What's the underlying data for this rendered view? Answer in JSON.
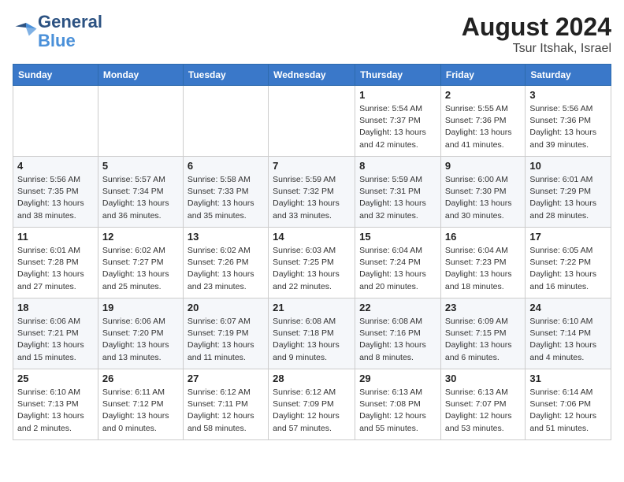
{
  "header": {
    "logo_line1": "General",
    "logo_line2": "Blue",
    "month_year": "August 2024",
    "location": "Tsur Itshak, Israel"
  },
  "weekdays": [
    "Sunday",
    "Monday",
    "Tuesday",
    "Wednesday",
    "Thursday",
    "Friday",
    "Saturday"
  ],
  "weeks": [
    [
      {
        "day": "",
        "info": ""
      },
      {
        "day": "",
        "info": ""
      },
      {
        "day": "",
        "info": ""
      },
      {
        "day": "",
        "info": ""
      },
      {
        "day": "1",
        "info": "Sunrise: 5:54 AM\nSunset: 7:37 PM\nDaylight: 13 hours\nand 42 minutes."
      },
      {
        "day": "2",
        "info": "Sunrise: 5:55 AM\nSunset: 7:36 PM\nDaylight: 13 hours\nand 41 minutes."
      },
      {
        "day": "3",
        "info": "Sunrise: 5:56 AM\nSunset: 7:36 PM\nDaylight: 13 hours\nand 39 minutes."
      }
    ],
    [
      {
        "day": "4",
        "info": "Sunrise: 5:56 AM\nSunset: 7:35 PM\nDaylight: 13 hours\nand 38 minutes."
      },
      {
        "day": "5",
        "info": "Sunrise: 5:57 AM\nSunset: 7:34 PM\nDaylight: 13 hours\nand 36 minutes."
      },
      {
        "day": "6",
        "info": "Sunrise: 5:58 AM\nSunset: 7:33 PM\nDaylight: 13 hours\nand 35 minutes."
      },
      {
        "day": "7",
        "info": "Sunrise: 5:59 AM\nSunset: 7:32 PM\nDaylight: 13 hours\nand 33 minutes."
      },
      {
        "day": "8",
        "info": "Sunrise: 5:59 AM\nSunset: 7:31 PM\nDaylight: 13 hours\nand 32 minutes."
      },
      {
        "day": "9",
        "info": "Sunrise: 6:00 AM\nSunset: 7:30 PM\nDaylight: 13 hours\nand 30 minutes."
      },
      {
        "day": "10",
        "info": "Sunrise: 6:01 AM\nSunset: 7:29 PM\nDaylight: 13 hours\nand 28 minutes."
      }
    ],
    [
      {
        "day": "11",
        "info": "Sunrise: 6:01 AM\nSunset: 7:28 PM\nDaylight: 13 hours\nand 27 minutes."
      },
      {
        "day": "12",
        "info": "Sunrise: 6:02 AM\nSunset: 7:27 PM\nDaylight: 13 hours\nand 25 minutes."
      },
      {
        "day": "13",
        "info": "Sunrise: 6:02 AM\nSunset: 7:26 PM\nDaylight: 13 hours\nand 23 minutes."
      },
      {
        "day": "14",
        "info": "Sunrise: 6:03 AM\nSunset: 7:25 PM\nDaylight: 13 hours\nand 22 minutes."
      },
      {
        "day": "15",
        "info": "Sunrise: 6:04 AM\nSunset: 7:24 PM\nDaylight: 13 hours\nand 20 minutes."
      },
      {
        "day": "16",
        "info": "Sunrise: 6:04 AM\nSunset: 7:23 PM\nDaylight: 13 hours\nand 18 minutes."
      },
      {
        "day": "17",
        "info": "Sunrise: 6:05 AM\nSunset: 7:22 PM\nDaylight: 13 hours\nand 16 minutes."
      }
    ],
    [
      {
        "day": "18",
        "info": "Sunrise: 6:06 AM\nSunset: 7:21 PM\nDaylight: 13 hours\nand 15 minutes."
      },
      {
        "day": "19",
        "info": "Sunrise: 6:06 AM\nSunset: 7:20 PM\nDaylight: 13 hours\nand 13 minutes."
      },
      {
        "day": "20",
        "info": "Sunrise: 6:07 AM\nSunset: 7:19 PM\nDaylight: 13 hours\nand 11 minutes."
      },
      {
        "day": "21",
        "info": "Sunrise: 6:08 AM\nSunset: 7:18 PM\nDaylight: 13 hours\nand 9 minutes."
      },
      {
        "day": "22",
        "info": "Sunrise: 6:08 AM\nSunset: 7:16 PM\nDaylight: 13 hours\nand 8 minutes."
      },
      {
        "day": "23",
        "info": "Sunrise: 6:09 AM\nSunset: 7:15 PM\nDaylight: 13 hours\nand 6 minutes."
      },
      {
        "day": "24",
        "info": "Sunrise: 6:10 AM\nSunset: 7:14 PM\nDaylight: 13 hours\nand 4 minutes."
      }
    ],
    [
      {
        "day": "25",
        "info": "Sunrise: 6:10 AM\nSunset: 7:13 PM\nDaylight: 13 hours\nand 2 minutes."
      },
      {
        "day": "26",
        "info": "Sunrise: 6:11 AM\nSunset: 7:12 PM\nDaylight: 13 hours\nand 0 minutes."
      },
      {
        "day": "27",
        "info": "Sunrise: 6:12 AM\nSunset: 7:11 PM\nDaylight: 12 hours\nand 58 minutes."
      },
      {
        "day": "28",
        "info": "Sunrise: 6:12 AM\nSunset: 7:09 PM\nDaylight: 12 hours\nand 57 minutes."
      },
      {
        "day": "29",
        "info": "Sunrise: 6:13 AM\nSunset: 7:08 PM\nDaylight: 12 hours\nand 55 minutes."
      },
      {
        "day": "30",
        "info": "Sunrise: 6:13 AM\nSunset: 7:07 PM\nDaylight: 12 hours\nand 53 minutes."
      },
      {
        "day": "31",
        "info": "Sunrise: 6:14 AM\nSunset: 7:06 PM\nDaylight: 12 hours\nand 51 minutes."
      }
    ]
  ]
}
